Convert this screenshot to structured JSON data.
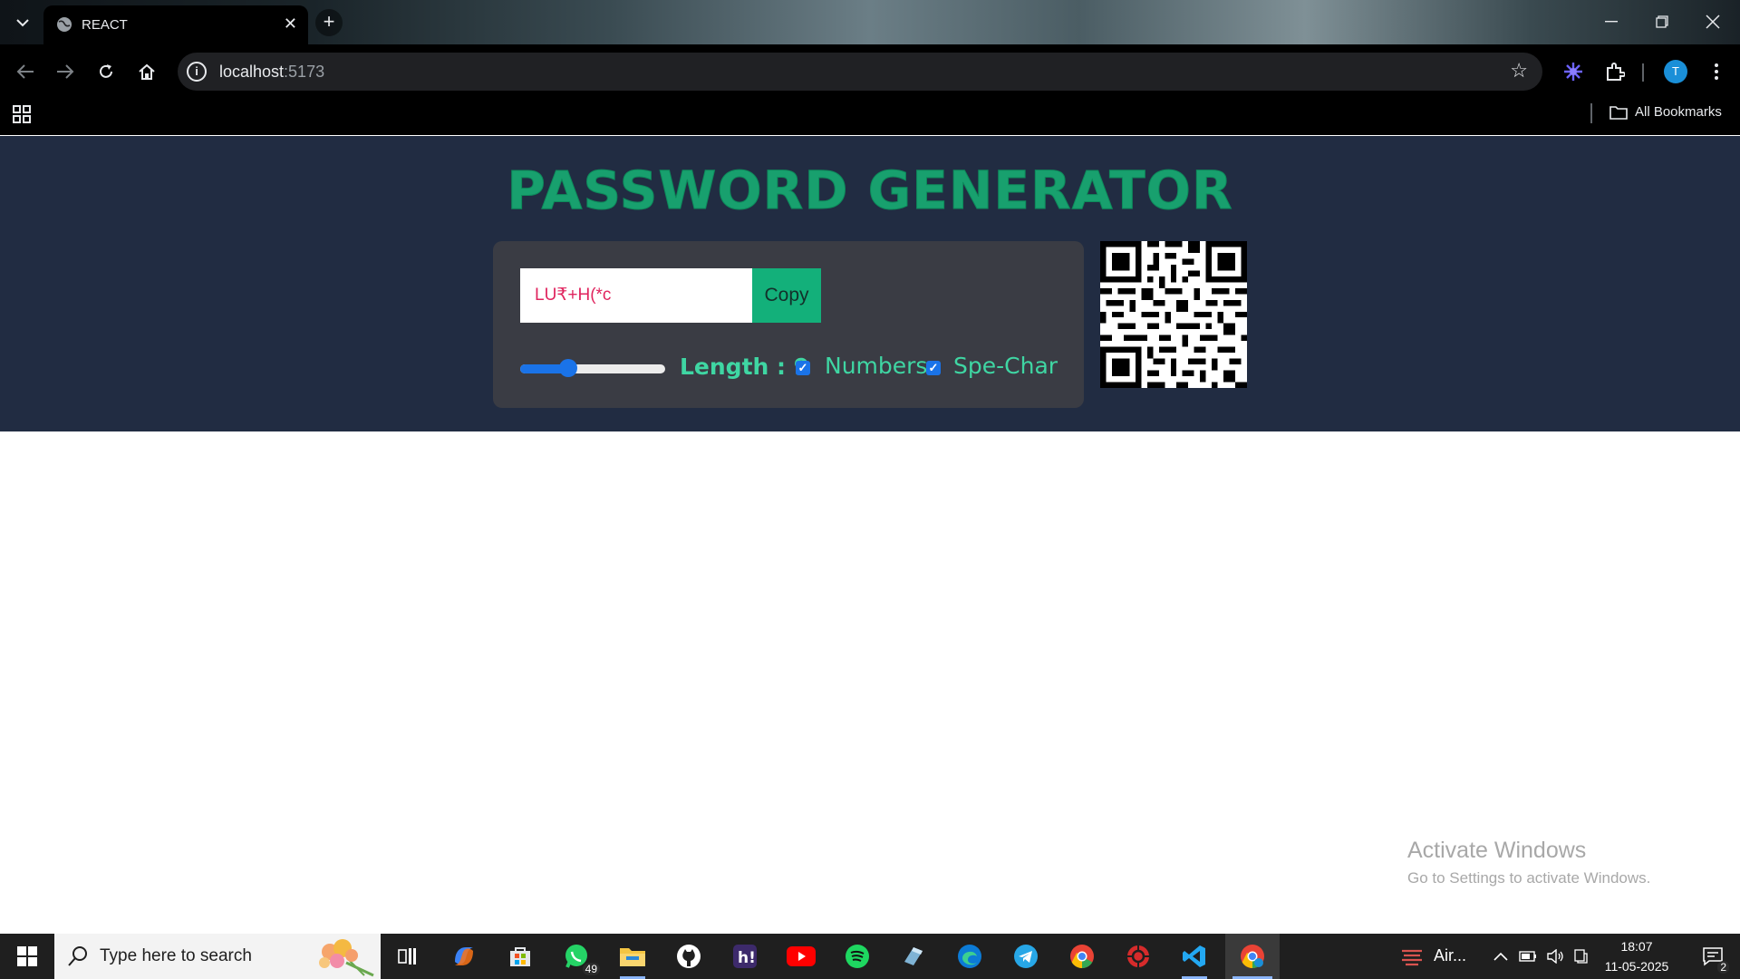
{
  "browser": {
    "tab_title": "REACT",
    "url_host": "localhost",
    "url_port": ":5173",
    "bookmarks_label": "All Bookmarks",
    "profile_initial": "T"
  },
  "app": {
    "title": "PASSWORD GENERATOR",
    "password_value": "LU₹+H(*c",
    "copy_label": "Copy",
    "length_label": "Length : 9",
    "length_value": 9,
    "numbers_label": "Numbers",
    "numbers_checked": true,
    "special_label": "Spe-Char",
    "special_checked": true,
    "accent_color": "#18a06e"
  },
  "watermark": {
    "line1": "Activate Windows",
    "line2": "Go to Settings to activate Windows."
  },
  "taskbar": {
    "search_placeholder": "Type here to search",
    "whatsapp_badge": "49",
    "tray_app_label": "Air...",
    "time": "18:07",
    "date": "11-05-2025",
    "notification_count": "2"
  }
}
